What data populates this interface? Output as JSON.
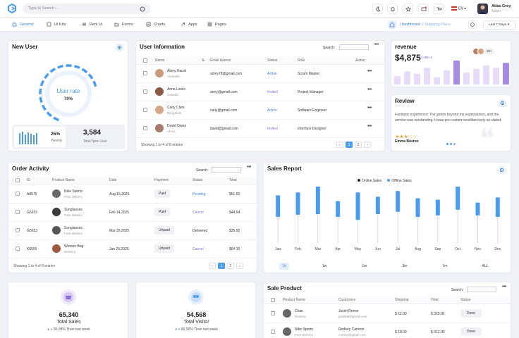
{
  "topbar": {
    "search_placeholder": "Type to Search ...",
    "language": "EN",
    "user_name": "Atlas Grey",
    "user_role": "Admin"
  },
  "nav": {
    "items": [
      "General",
      "UI Kits",
      "Perk Ui",
      "Forms",
      "Charts",
      "Apps",
      "Pages"
    ],
    "breadcrumb_parent": "/ bashboard",
    "breadcrumb_current": "/ Shipping Place",
    "range_button": "Last 7 Days"
  },
  "new_user": {
    "title": "New User",
    "gauge_label": "User rate",
    "gauge_value": "70%",
    "gauge_level": 0.7,
    "weekly_pct": "25%",
    "weekly_label": "Weekly",
    "total_value": "3,584",
    "total_label": "Total New User"
  },
  "user_info": {
    "title": "User Information",
    "search_label": "Search:",
    "headers": [
      "Name",
      "Email Adress",
      "Status",
      "Role",
      "Action"
    ],
    "rows": [
      {
        "name": "Alony Haust",
        "location": "Australia",
        "email": "alony78@gmail.com",
        "status": "Active",
        "role": "Scrum Master"
      },
      {
        "name": "Anna Lewis",
        "location": "Canada",
        "email": "anny@gmail.com",
        "status": "Invited",
        "role": "Project Manager"
      },
      {
        "name": "Carly Clark",
        "location": "Bangalore",
        "email": "carly@gmail.com",
        "status": "Active",
        "role": "Software Engineer"
      },
      {
        "name": "David Owen",
        "location": "Africa",
        "email": "david@gmail.com",
        "status": "Invited",
        "role": "Interface Designer"
      }
    ],
    "footer": "Showing 1 to 4 of 8 entries",
    "pages": [
      "‹",
      "1",
      "2",
      "›"
    ]
  },
  "revenue": {
    "title": "revenue",
    "value": "$4,875",
    "change": "10.28% ▾",
    "more": "20+",
    "bars": [
      0.35,
      0.55,
      0.45,
      0.7,
      0.3,
      0.6,
      1.0,
      0.5,
      0.65,
      0.8,
      0.7,
      0.9
    ]
  },
  "review": {
    "title": "Review",
    "text": "Fantastic experience! The goods beyond my expectations, and the service was outstanding. It was pre.custom-scrollbarcisely as stated.",
    "stars": "★★★☆☆",
    "author": "Emma Buston"
  },
  "order_activity": {
    "title": "Order Activity",
    "search_label": "Search:",
    "headers": [
      "ID",
      "Product Name",
      "Date",
      "Payment",
      "Status",
      "Total"
    ],
    "rows": [
      {
        "id": "A8576",
        "product": "Nike Sports",
        "delivery": "Free delivery",
        "date": "Aug 15,2025",
        "payment": "Paid",
        "status": "Pending",
        "total": "$51.50"
      },
      {
        "id": "G5653",
        "product": "Sunglasses",
        "delivery": "Free delivery",
        "date": "Feb 14,2025",
        "payment": "Paid",
        "status": "Cancel",
        "total": "$44.54"
      },
      {
        "id": "G5653",
        "product": "Sunglasses",
        "delivery": "Free delivery",
        "date": "Mar 25,2025",
        "payment": "Unpaid",
        "status": "Delivered",
        "total": "$35.95"
      },
      {
        "id": "K6556",
        "product": "Women Bag",
        "delivery": "Delivery",
        "date": "Jan 25,2025",
        "payment": "Unpaid",
        "status": "Cancel",
        "total": "$64.16"
      }
    ],
    "footer": "Showing 1 to 4 of 8 entries",
    "pages": [
      "‹",
      "1",
      "2",
      "›"
    ]
  },
  "chart_data": {
    "type": "bar",
    "title": "Sales Report",
    "categories": [
      "Jan",
      "Feb",
      "Mar",
      "Apr",
      "May",
      "Jun",
      "Jul",
      "Aug",
      "Sep",
      "Oct",
      "Nov",
      "Dec"
    ],
    "series": [
      {
        "name": "Online Sales",
        "values": [
          0,
          0,
          0,
          0,
          0,
          0,
          0,
          0,
          0,
          0,
          0,
          0
        ]
      },
      {
        "name": "Offline Sales",
        "low": [
          36,
          39,
          40,
          36,
          32,
          40,
          43,
          36,
          38,
          46,
          38,
          36
        ],
        "high": [
          66,
          70,
          78,
          58,
          70,
          64,
          72,
          62,
          60,
          78,
          56,
          63
        ]
      }
    ],
    "ylim": [
      0,
      80
    ],
    "legend": "top-center",
    "ranges": [
      "1d",
      "1w",
      "1m",
      "3m",
      "1m",
      "ALL"
    ],
    "active_range": "1d"
  },
  "stats": [
    {
      "value": "65,340",
      "label": "Total Sales",
      "change": "+ 90.28%",
      "note": "Than last week",
      "color": "#8a6bd5"
    },
    {
      "value": "54,568",
      "label": "Total Visitor",
      "change": "+ 80.50%",
      "note": "Than last week",
      "color": "#4a9cef"
    }
  ],
  "sale_product": {
    "title": "Sale Product",
    "search_label": "Search:",
    "headers": [
      "Product Name",
      "Customers",
      "Shipping",
      "Total",
      "Status"
    ],
    "rows": [
      {
        "product": "Chair",
        "delivery": "Delivery",
        "customer": "Joziel Reese",
        "email": "jaziel68@gmail.com",
        "shipping": "$ 62.00",
        "total": "$ 325.00",
        "status": "Done"
      },
      {
        "product": "Nike Sports",
        "delivery": "Free delivery",
        "customer": "Rodney Camron",
        "email": "rodney@gmail.com",
        "shipping": "$ 18.00",
        "total": "$ 512.00",
        "status": "Done"
      }
    ]
  },
  "colors": {
    "accent": "#3a7bd5",
    "bar": "#4a9cef",
    "purple": "#8a6bd5"
  }
}
